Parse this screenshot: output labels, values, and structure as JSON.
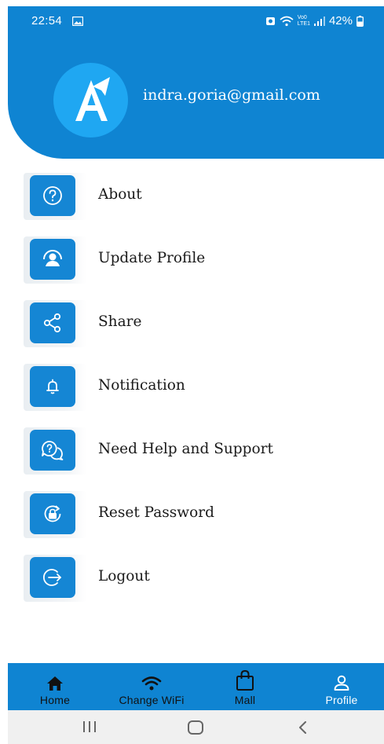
{
  "status_bar": {
    "time": "22:54",
    "battery": "42%",
    "network_label_top": "Vo0",
    "network_label_bottom": "LTE1"
  },
  "header": {
    "avatar_letter": "A",
    "email": "indra.goria@gmail.com"
  },
  "menu": [
    {
      "label": "About",
      "icon": "help-circle-icon"
    },
    {
      "label": "Update Profile",
      "icon": "user-circle-icon"
    },
    {
      "label": "Share",
      "icon": "share-icon"
    },
    {
      "label": "Notification",
      "icon": "bell-icon"
    },
    {
      "label": "Need Help and Support",
      "icon": "chat-question-icon"
    },
    {
      "label": "Reset Password",
      "icon": "lock-reset-icon"
    },
    {
      "label": "Logout",
      "icon": "logout-icon"
    }
  ],
  "bottom_nav": [
    {
      "label": "Home",
      "icon": "home-icon",
      "active": false
    },
    {
      "label": "Change WiFi",
      "icon": "wifi-icon",
      "active": false
    },
    {
      "label": "Mall",
      "icon": "shopping-bag-icon",
      "active": false
    },
    {
      "label": "Profile",
      "icon": "person-icon",
      "active": true
    }
  ],
  "colors": {
    "primary": "#0f84d2",
    "icon_tile": "#1586d4",
    "avatar_bg": "#1fa7f2",
    "text_dark": "#1a1a1a",
    "system_nav_bg": "#f0f0f0"
  }
}
